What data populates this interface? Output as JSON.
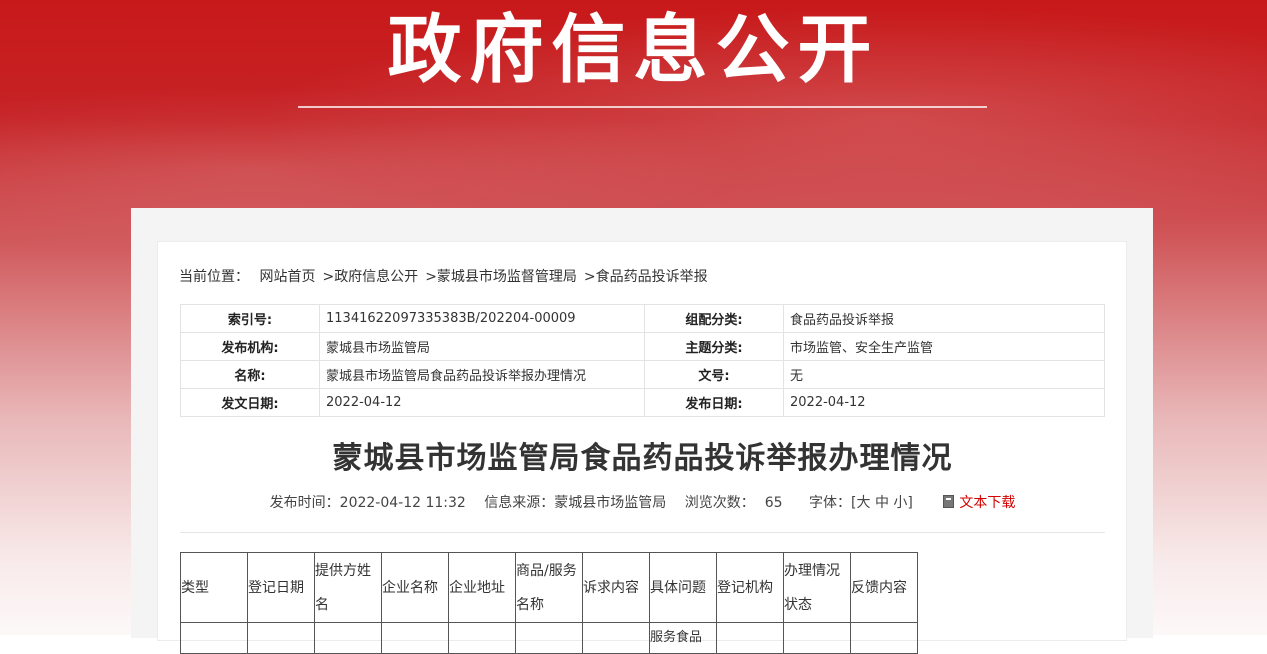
{
  "banner": {
    "title": "政府信息公开"
  },
  "breadcrumb": {
    "prefix": "当前位置：",
    "items": [
      "网站首页",
      "政府信息公开",
      "蒙城县市场监督管理局",
      "食品药品投诉举报"
    ],
    "separator": ">"
  },
  "meta": {
    "rows": [
      {
        "label1": "索引号:",
        "value1": "11341622097335383B/202204-00009",
        "label2": "组配分类:",
        "value2": "食品药品投诉举报"
      },
      {
        "label1": "发布机构:",
        "value1": "蒙城县市场监管局",
        "label2": "主题分类:",
        "value2": "市场监管、安全生产监管"
      },
      {
        "label1": "名称:",
        "value1": "蒙城县市场监管局食品药品投诉举报办理情况",
        "label2": "文号:",
        "value2": "无"
      },
      {
        "label1": "发文日期:",
        "value1": "2022-04-12",
        "label2": "发布日期:",
        "value2": "2022-04-12"
      }
    ]
  },
  "article": {
    "title": "蒙城县市场监管局食品药品投诉举报办理情况",
    "publish_time_label": "发布时间：",
    "publish_time": "2022-04-12 11:32",
    "source_label": "信息来源：",
    "source": "蒙城县市场监管局",
    "views_label": "浏览次数：",
    "views": "65",
    "font_label": "字体：",
    "font_open": "[",
    "font_large": "大",
    "font_medium": "中",
    "font_small": "小",
    "font_close": "]",
    "download_label": "文本下载"
  },
  "data_table": {
    "headers": [
      "类型",
      "登记日期",
      "提供方姓名",
      "企业名称",
      "企业地址",
      "商品/服务名称",
      "诉求内容",
      "具体问题",
      "登记机构",
      "办理情况状态",
      "反馈内容"
    ],
    "partial_cell": "服务食品"
  },
  "colors": {
    "brand_red": "#c8191a",
    "link_red": "#d40000"
  }
}
